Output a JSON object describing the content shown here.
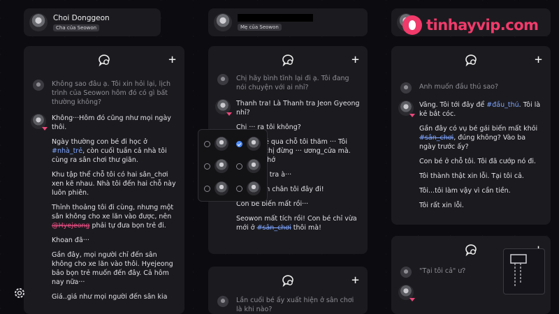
{
  "watermark": {
    "text": "tinhayvip.com"
  },
  "headers": [
    {
      "name": "Choi Donggeon",
      "badge": "Cha của Seowon"
    },
    {
      "name": "",
      "badge": "Mẹ của Seowon"
    }
  ],
  "columns": [
    {
      "messages": [
        {
          "kind": "user",
          "paras": [
            "Không sao đâu ạ. Tôi xin hỏi lại, lịch trình của Seowon hôm đó có gì bất thường không?"
          ]
        },
        {
          "kind": "npc",
          "paras": [
            "Không···Hôm đó cũng như mọi ngày thôi.",
            "Ngày thường con bé đi học ở #nhà_trẻ, còn cuối tuần cả nhà tôi cùng ra sân chơi thư giãn.",
            "Khu tập thể chỗ tôi có hai sân_chơi xen kẽ nhau. Nhà tôi đến hai chỗ này luôn phiên.",
            "Thỉnh thoảng tôi đi cùng, nhưng một sân không cho xe lăn vào được, nên @Hyejeong phải tự đưa bọn trẻ đi.",
            "Khoan đã···",
            "Gần đây, mọi người chỉ đến sân không cho xe lăn vào thôi. Hyejeong bảo bọn trẻ muốn đến đây. Cả hôm nay nữa···",
            "Giá..giá như mọi người đến sân kia"
          ]
        }
      ]
    },
    {
      "messages": [
        {
          "kind": "user",
          "paras": [
            "Chị hãy bình tĩnh lại đi ạ. Tôi đang nói chuyện với ai nhỉ?"
          ]
        },
        {
          "kind": "npc",
          "paras": [
            "Thanh tra! Là Thanh tra Jeon Gyeong nhỉ?",
            "Chị ··· ra tôi không?",
            "··· chị ghé qua chỗ tôi thăm ··· Tôi còn bảo chị đừng ··· ương_cửa mà. Làm ơn nhớ",
            "···, Thanh tra à···",
            "Chị nhanh chân tôi đây đi!",
            "Con bé biến mất rồi···",
            "Seowon mất tích rồi! Con bé chỉ vừa mới ở #sân_chơi thôi mà!"
          ]
        }
      ]
    },
    {
      "messages": [
        {
          "kind": "user",
          "paras": [
            "Lần cuối bé ấy xuất hiện ở sân chơi là khi nào?"
          ]
        }
      ]
    },
    {
      "messages": [
        {
          "kind": "user",
          "paras": [
            "Anh muốn đầu thú sao?"
          ]
        },
        {
          "kind": "npc",
          "paras": [
            "Vâng. Tôi tới đây để #đầu_thú. Tôi là kẻ bắt cóc.",
            "Gần đây có vụ bé gái biến mất khỏi #sân_chơi, đúng không? Vào ba ngày trước ấy?",
            "Con bé ở chỗ tôi. Tôi đã cướp nó đi.",
            "Tôi thành thật xin lỗi. Tại tôi cả.",
            "Tôi...tôi làm vậy vì cần tiền.",
            "Tôi rất xin lỗi."
          ]
        }
      ]
    },
    {
      "messages": [
        {
          "kind": "user",
          "paras": [
            "\"Tại tôi cả\" ư?"
          ]
        }
      ]
    }
  ],
  "toolbar": {
    "add_label": "+"
  }
}
